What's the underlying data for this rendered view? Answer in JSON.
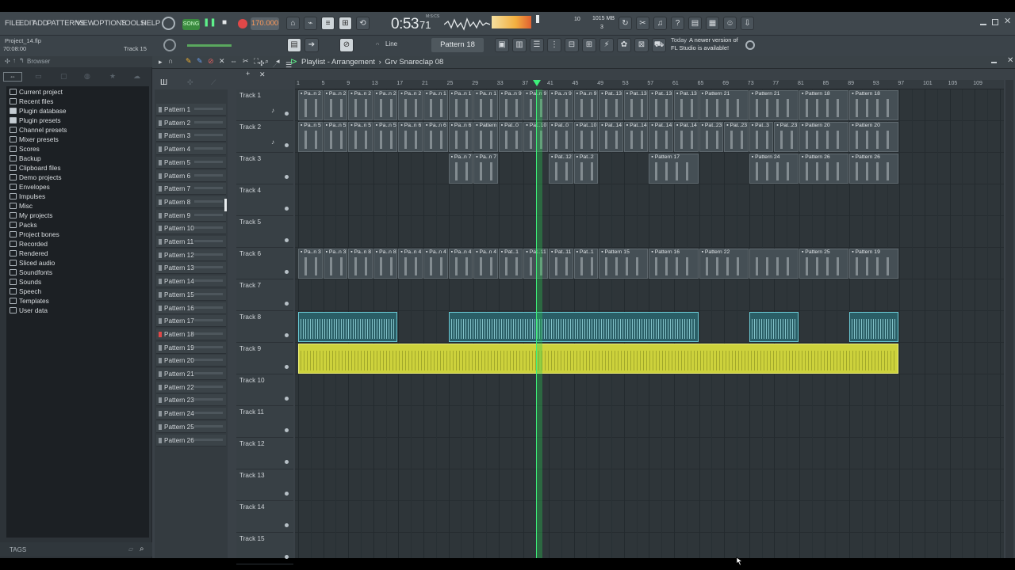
{
  "menu": [
    "FILE",
    "EDIT",
    "ADD",
    "PATTERNS",
    "VIEW",
    "OPTIONS",
    "TOOLS",
    "HELP"
  ],
  "transport": {
    "mode": "SONG",
    "tempo": "170.000",
    "time": "0:53",
    "time_frac": "71",
    "time_unit": "M:S:CS"
  },
  "monitor": {
    "cpu": "10",
    "memory": "1015 MB",
    "poly": "3"
  },
  "project": {
    "file": "Project_14.flp",
    "duration": "70:08:00",
    "hint": "Track 15"
  },
  "toolbar2": {
    "snap": "Line",
    "pattern": "Pattern 18"
  },
  "news": {
    "date": "Today",
    "line1": "A newer version of",
    "line2": "FL Studio is available!"
  },
  "browser": {
    "label": "Browser",
    "items": [
      "Current project",
      "Recent files",
      "Plugin database",
      "Plugin presets",
      "Channel presets",
      "Mixer presets",
      "Scores",
      "Backup",
      "Clipboard files",
      "Demo projects",
      "Envelopes",
      "Impulses",
      "Misc",
      "My projects",
      "Packs",
      "Project bones",
      "Recorded",
      "Rendered",
      "Sliced audio",
      "Soundfonts",
      "Sounds",
      "Speech",
      "Templates",
      "User data"
    ],
    "tags": "TAGS"
  },
  "playlist": {
    "title": "Playlist - Arrangement",
    "separator": "›",
    "clip": "Grv Snareclap 08"
  },
  "patterns": [
    "Pattern 1",
    "Pattern 2",
    "Pattern 3",
    "Pattern 4",
    "Pattern 5",
    "Pattern 6",
    "Pattern 7",
    "Pattern 8",
    "Pattern 9",
    "Pattern 10",
    "Pattern 11",
    "Pattern 12",
    "Pattern 13",
    "Pattern 14",
    "Pattern 15",
    "Pattern 16",
    "Pattern 17",
    "Pattern 18",
    "Pattern 19",
    "Pattern 20",
    "Pattern 21",
    "Pattern 22",
    "Pattern 23",
    "Pattern 24",
    "Pattern 25",
    "Pattern 26"
  ],
  "tracks": [
    "Track 1",
    "Track 2",
    "Track 3",
    "Track 4",
    "Track 5",
    "Track 6",
    "Track 7",
    "Track 8",
    "Track 9",
    "Track 10",
    "Track 11",
    "Track 12",
    "Track 13",
    "Track 14",
    "Track 15"
  ],
  "ruler": [
    "1",
    "5",
    "9",
    "13",
    "17",
    "21",
    "25",
    "29",
    "33",
    "37",
    "41",
    "45",
    "49",
    "53",
    "57",
    "61",
    "65",
    "69",
    "73",
    "77",
    "81",
    "85",
    "89",
    "93",
    "97",
    "101",
    "105",
    "109"
  ],
  "clips": [
    {
      "track": 0,
      "bar": 1,
      "len": 4,
      "label": "Pa..n 2",
      "kind": "pattern"
    },
    {
      "track": 0,
      "bar": 5,
      "len": 4,
      "label": "Pa..n 2",
      "kind": "pattern"
    },
    {
      "track": 0,
      "bar": 9,
      "len": 4,
      "label": "Pa..n 2",
      "kind": "pattern"
    },
    {
      "track": 0,
      "bar": 13,
      "len": 4,
      "label": "Pa..n 2",
      "kind": "pattern"
    },
    {
      "track": 0,
      "bar": 17,
      "len": 4,
      "label": "Pa..n 2",
      "kind": "pattern"
    },
    {
      "track": 0,
      "bar": 21,
      "len": 4,
      "label": "Pa..n 1",
      "kind": "pattern"
    },
    {
      "track": 0,
      "bar": 25,
      "len": 4,
      "label": "Pa..n 1",
      "kind": "pattern"
    },
    {
      "track": 0,
      "bar": 29,
      "len": 4,
      "label": "Pa..n 1",
      "kind": "pattern"
    },
    {
      "track": 0,
      "bar": 33,
      "len": 4,
      "label": "Pa..n 9",
      "kind": "pattern"
    },
    {
      "track": 0,
      "bar": 37,
      "len": 4,
      "label": "Pa..n 9",
      "kind": "pattern"
    },
    {
      "track": 0,
      "bar": 41,
      "len": 4,
      "label": "Pa..n 9",
      "kind": "pattern"
    },
    {
      "track": 0,
      "bar": 45,
      "len": 4,
      "label": "Pa..n 9",
      "kind": "pattern"
    },
    {
      "track": 0,
      "bar": 49,
      "len": 4,
      "label": "Pat..13",
      "kind": "pattern"
    },
    {
      "track": 0,
      "bar": 53,
      "len": 4,
      "label": "Pat..13",
      "kind": "pattern"
    },
    {
      "track": 0,
      "bar": 57,
      "len": 4,
      "label": "Pat..13",
      "kind": "pattern"
    },
    {
      "track": 0,
      "bar": 61,
      "len": 4,
      "label": "Pat..13",
      "kind": "pattern"
    },
    {
      "track": 0,
      "bar": 65,
      "len": 8,
      "label": "Pattern 21",
      "kind": "pattern"
    },
    {
      "track": 0,
      "bar": 73,
      "len": 8,
      "label": "Pattern 21",
      "kind": "pattern"
    },
    {
      "track": 0,
      "bar": 81,
      "len": 8,
      "label": "Pattern 18",
      "kind": "pattern"
    },
    {
      "track": 0,
      "bar": 89,
      "len": 8,
      "label": "Pattern 18",
      "kind": "pattern"
    },
    {
      "track": 1,
      "bar": 1,
      "len": 4,
      "label": "Pa..n 5",
      "kind": "pattern"
    },
    {
      "track": 1,
      "bar": 5,
      "len": 4,
      "label": "Pa..n 5",
      "kind": "pattern"
    },
    {
      "track": 1,
      "bar": 9,
      "len": 4,
      "label": "Pa..n 5",
      "kind": "pattern"
    },
    {
      "track": 1,
      "bar": 13,
      "len": 4,
      "label": "Pa..n 5",
      "kind": "pattern"
    },
    {
      "track": 1,
      "bar": 17,
      "len": 4,
      "label": "Pa..n 6",
      "kind": "pattern"
    },
    {
      "track": 1,
      "bar": 21,
      "len": 4,
      "label": "Pa..n 6",
      "kind": "pattern"
    },
    {
      "track": 1,
      "bar": 25,
      "len": 4,
      "label": "Pa..n 6",
      "kind": "pattern"
    },
    {
      "track": 1,
      "bar": 29,
      "len": 4,
      "label": "Pattern",
      "kind": "pattern"
    },
    {
      "track": 1,
      "bar": 33,
      "len": 4,
      "label": "Pat..0",
      "kind": "pattern"
    },
    {
      "track": 1,
      "bar": 37,
      "len": 4,
      "label": "Pat..10",
      "kind": "pattern"
    },
    {
      "track": 1,
      "bar": 41,
      "len": 4,
      "label": "Pat..0",
      "kind": "pattern"
    },
    {
      "track": 1,
      "bar": 45,
      "len": 4,
      "label": "Pat..10",
      "kind": "pattern"
    },
    {
      "track": 1,
      "bar": 49,
      "len": 4,
      "label": "Pat..14",
      "kind": "pattern"
    },
    {
      "track": 1,
      "bar": 53,
      "len": 4,
      "label": "Pat..14",
      "kind": "pattern"
    },
    {
      "track": 1,
      "bar": 57,
      "len": 4,
      "label": "Pat..14",
      "kind": "pattern"
    },
    {
      "track": 1,
      "bar": 61,
      "len": 4,
      "label": "Pat..14",
      "kind": "pattern"
    },
    {
      "track": 1,
      "bar": 65,
      "len": 4,
      "label": "Pat..23",
      "kind": "pattern"
    },
    {
      "track": 1,
      "bar": 69,
      "len": 4,
      "label": "Pat..23",
      "kind": "pattern"
    },
    {
      "track": 1,
      "bar": 73,
      "len": 4,
      "label": "Pat..3",
      "kind": "pattern"
    },
    {
      "track": 1,
      "bar": 77,
      "len": 4,
      "label": "Pat..23",
      "kind": "pattern"
    },
    {
      "track": 1,
      "bar": 81,
      "len": 8,
      "label": "Pattern 20",
      "kind": "pattern"
    },
    {
      "track": 1,
      "bar": 89,
      "len": 8,
      "label": "Pattern 20",
      "kind": "pattern"
    },
    {
      "track": 2,
      "bar": 25,
      "len": 4,
      "label": "Pa..n 7",
      "kind": "pattern"
    },
    {
      "track": 2,
      "bar": 29,
      "len": 4,
      "label": "Pa..n 7",
      "kind": "pattern"
    },
    {
      "track": 2,
      "bar": 41,
      "len": 4,
      "label": "Pat..12",
      "kind": "pattern"
    },
    {
      "track": 2,
      "bar": 45,
      "len": 4,
      "label": "Pat..2",
      "kind": "pattern"
    },
    {
      "track": 2,
      "bar": 57,
      "len": 8,
      "label": "Pattern 17",
      "kind": "pattern"
    },
    {
      "track": 2,
      "bar": 73,
      "len": 8,
      "label": "Pattern 24",
      "kind": "pattern"
    },
    {
      "track": 2,
      "bar": 81,
      "len": 8,
      "label": "Pattern 26",
      "kind": "pattern"
    },
    {
      "track": 2,
      "bar": 89,
      "len": 8,
      "label": "Pattern 26",
      "kind": "pattern"
    },
    {
      "track": 5,
      "bar": 1,
      "len": 4,
      "label": "Pa..n 3",
      "kind": "pattern"
    },
    {
      "track": 5,
      "bar": 5,
      "len": 4,
      "label": "Pa..n 3",
      "kind": "pattern"
    },
    {
      "track": 5,
      "bar": 9,
      "len": 4,
      "label": "Pa..n 8",
      "kind": "pattern"
    },
    {
      "track": 5,
      "bar": 13,
      "len": 4,
      "label": "Pa..n 8",
      "kind": "pattern"
    },
    {
      "track": 5,
      "bar": 17,
      "len": 4,
      "label": "Pa..n 4",
      "kind": "pattern"
    },
    {
      "track": 5,
      "bar": 21,
      "len": 4,
      "label": "Pa..n 4",
      "kind": "pattern"
    },
    {
      "track": 5,
      "bar": 25,
      "len": 4,
      "label": "Pa..n 4",
      "kind": "pattern"
    },
    {
      "track": 5,
      "bar": 29,
      "len": 4,
      "label": "Pa..n 4",
      "kind": "pattern"
    },
    {
      "track": 5,
      "bar": 33,
      "len": 4,
      "label": "Pat..1",
      "kind": "pattern"
    },
    {
      "track": 5,
      "bar": 37,
      "len": 4,
      "label": "Pat..11",
      "kind": "pattern"
    },
    {
      "track": 5,
      "bar": 41,
      "len": 4,
      "label": "Pat..11",
      "kind": "pattern"
    },
    {
      "track": 5,
      "bar": 45,
      "len": 4,
      "label": "Pat..1",
      "kind": "pattern"
    },
    {
      "track": 5,
      "bar": 49,
      "len": 8,
      "label": "Pattern 15",
      "kind": "pattern"
    },
    {
      "track": 5,
      "bar": 57,
      "len": 8,
      "label": "Pattern 16",
      "kind": "pattern"
    },
    {
      "track": 5,
      "bar": 65,
      "len": 8,
      "label": "Pattern 22",
      "kind": "pattern"
    },
    {
      "track": 5,
      "bar": 73,
      "len": 8,
      "label": "",
      "kind": "pattern"
    },
    {
      "track": 5,
      "bar": 81,
      "len": 8,
      "label": "Pattern 25",
      "kind": "pattern"
    },
    {
      "track": 5,
      "bar": 89,
      "len": 8,
      "label": "Pattern 19",
      "kind": "pattern"
    },
    {
      "track": 7,
      "bar": 1,
      "len": 16,
      "label": "",
      "kind": "audio-teal"
    },
    {
      "track": 7,
      "bar": 25,
      "len": 40,
      "label": "",
      "kind": "audio-teal"
    },
    {
      "track": 7,
      "bar": 73,
      "len": 8,
      "label": "",
      "kind": "audio-teal"
    },
    {
      "track": 7,
      "bar": 89,
      "len": 8,
      "label": "",
      "kind": "audio-teal"
    },
    {
      "track": 8,
      "bar": 1,
      "len": 96,
      "label": "",
      "kind": "audio-yellow"
    }
  ],
  "playhead_bar": 39,
  "selected_pattern": "Pattern 18",
  "colors": {
    "accent": "#3df07a",
    "teal": "#68c7d2",
    "yellow": "#cdd23c",
    "panel": "#3a4147"
  }
}
